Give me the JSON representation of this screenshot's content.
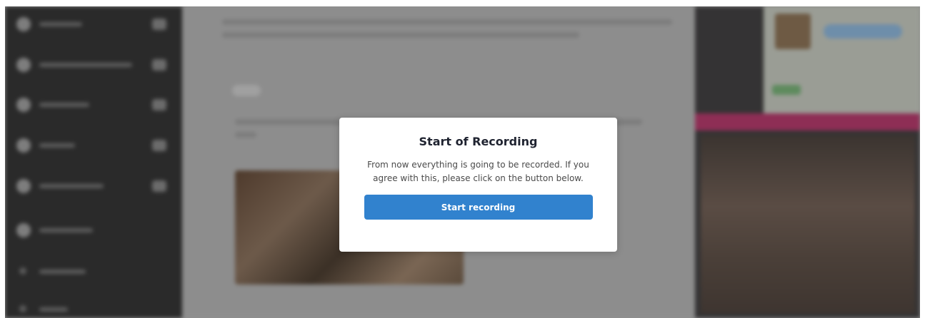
{
  "modal": {
    "title": "Start of Recording",
    "body": "From now everything is going to be recorded. If you agree with this, please click on the button below.",
    "button_label": "Start recording"
  },
  "colors": {
    "button_bg": "#3182ce",
    "button_text": "#ffffff",
    "overlay": "#8e8e8e",
    "modal_bg": "#ffffff"
  }
}
